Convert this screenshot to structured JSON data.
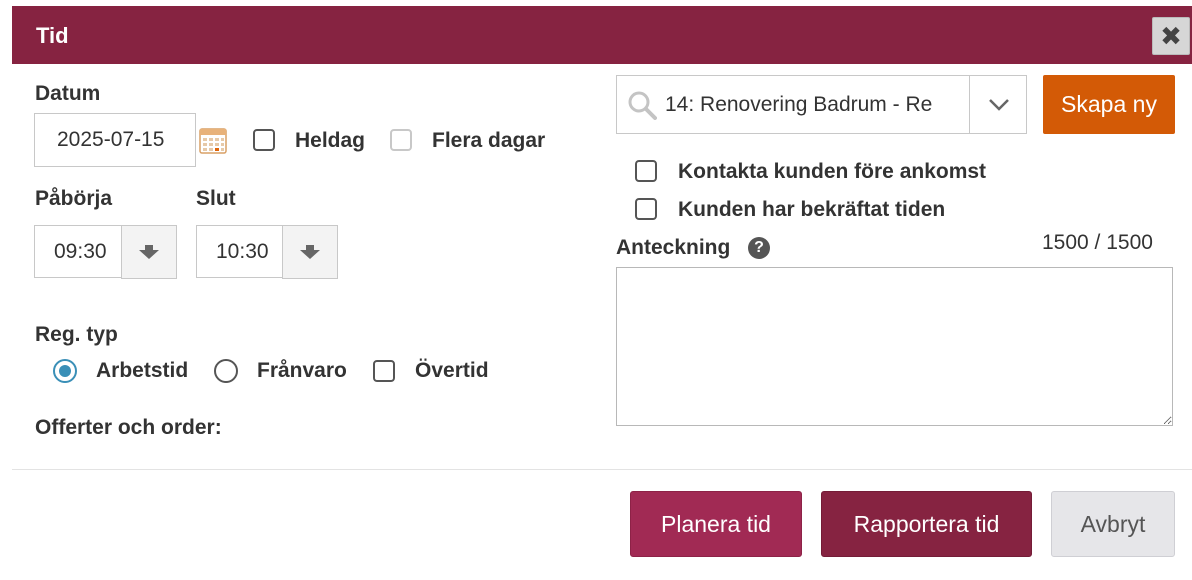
{
  "dialog": {
    "title": "Tid"
  },
  "date": {
    "label": "Datum",
    "value": "2025-07-15",
    "allday_label": "Heldag",
    "multiday_label": "Flera dagar"
  },
  "time": {
    "start_label": "Påbörja",
    "start_value": "09:30",
    "end_label": "Slut",
    "end_value": "10:30"
  },
  "reg_type": {
    "label": "Reg. typ",
    "options": [
      "Arbetstid",
      "Frånvaro",
      "Övertid"
    ],
    "selected": "Arbetstid"
  },
  "offers": {
    "label": "Offerter och order:"
  },
  "project": {
    "value": "14: Renovering Badrum - Re",
    "create_label": "Skapa ny"
  },
  "options": {
    "contact_label": "Kontakta kunden före ankomst",
    "confirmed_label": "Kunden har bekräftat tiden"
  },
  "note": {
    "label": "Anteckning",
    "counter": "1500 / 1500",
    "value": ""
  },
  "footer": {
    "plan_label": "Planera tid",
    "report_label": "Rapportera tid",
    "cancel_label": "Avbryt"
  },
  "colors": {
    "title_bg": "#862341",
    "plan_bg": "#a12a54",
    "report_bg": "#862341",
    "create_bg": "#d35a06",
    "radio_accent": "#3a8fb7"
  }
}
